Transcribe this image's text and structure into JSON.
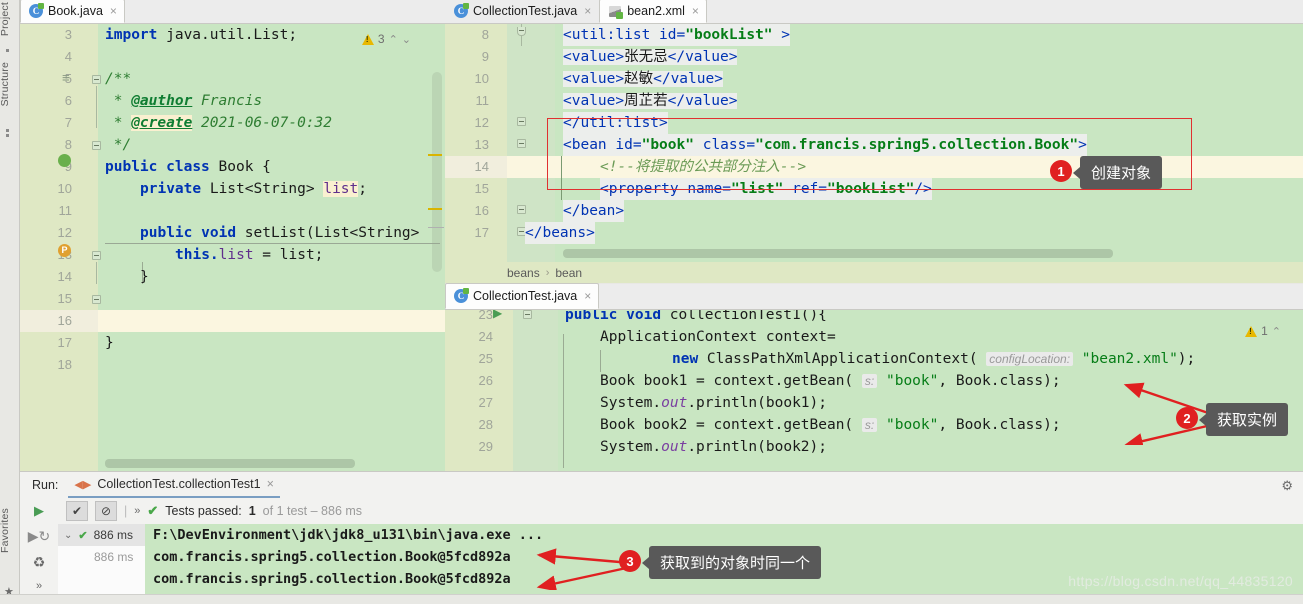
{
  "app": {
    "watermark": "https://blog.csdn.net/qq_44835120"
  },
  "tool_strip": {
    "project_label": "Project",
    "structure_label": "Structure",
    "favorites_label": "Favorites"
  },
  "editor_left": {
    "tab": {
      "label": "Book.java",
      "icon": "java-class-icon",
      "close": "×"
    },
    "inspection": {
      "warn_count": "3",
      "up": "⌃",
      "down": "⌄"
    },
    "line_numbers": [
      "3",
      "4",
      "5",
      "6",
      "7",
      "8",
      "9",
      "10",
      "11",
      "12",
      "13",
      "14",
      "15",
      "16",
      "17",
      "18"
    ],
    "lines": [
      {
        "n": "3",
        "text": "import java.util.List;"
      },
      {
        "n": "4",
        "text": ""
      },
      {
        "n": "5",
        "text": "/**"
      },
      {
        "n": "6",
        "text": " * @author Francis"
      },
      {
        "n": "7",
        "text": " * @create 2021-06-07-0:32"
      },
      {
        "n": "8",
        "text": " */"
      },
      {
        "n": "9",
        "text": "public class Book {"
      },
      {
        "n": "10",
        "text": "    private List<String> list;"
      },
      {
        "n": "11",
        "text": ""
      },
      {
        "n": "12",
        "text": "    public void setList(List<String> list) {"
      },
      {
        "n": "13",
        "text": "        this.list = list;"
      },
      {
        "n": "14",
        "text": "    }"
      },
      {
        "n": "15",
        "text": ""
      },
      {
        "n": "16",
        "text": ""
      },
      {
        "n": "17",
        "text": "}"
      },
      {
        "n": "18",
        "text": ""
      }
    ],
    "tokens": {
      "import_kw": "import",
      "import_pkg": " java.util.List;",
      "doc_open": "/**",
      "doc_star1": " * ",
      "doc_author": "@author",
      "doc_author_val": " Francis",
      "doc_star2": " * ",
      "doc_create": "@create",
      "doc_create_val": " 2021-06-07-0:32",
      "doc_close": " */",
      "public": "public",
      "class": "class",
      "book": "Book",
      "brace_open": "{",
      "private": "private",
      "list_type": "List<String>",
      "list_field": "list",
      "semi": ";",
      "void": "void",
      "setlist": "setList(",
      "list_param": "List<String>",
      "this_list": "this.",
      "assign": " = list;",
      "close_brace": "}",
      "class_close": "}"
    }
  },
  "editor_xml": {
    "tabs": [
      {
        "label": "CollectionTest.java",
        "icon": "java-class-icon",
        "active": false,
        "close": "×"
      },
      {
        "label": "bean2.xml",
        "icon": "xml-file-icon",
        "active": true,
        "close": "×"
      }
    ],
    "line_numbers": [
      "8",
      "9",
      "10",
      "11",
      "12",
      "13",
      "14",
      "15",
      "16",
      "17"
    ],
    "lines": [
      {
        "n": "8",
        "text": "<util:list id=\"bookList\" >"
      },
      {
        "n": "9",
        "text": "    <value>张无忌</value>"
      },
      {
        "n": "10",
        "text": "    <value>赵敏</value>"
      },
      {
        "n": "11",
        "text": "    <value>周芷若</value>"
      },
      {
        "n": "12",
        "text": "</util:list>"
      },
      {
        "n": "13",
        "text": "<bean id=\"book\" class=\"com.francis.spring5.collection.Book\">"
      },
      {
        "n": "14",
        "text": "    <!--将提取的公共部分注入-->"
      },
      {
        "n": "15",
        "text": "    <property name=\"list\" ref=\"bookList\"/>"
      },
      {
        "n": "16",
        "text": "</bean>"
      },
      {
        "n": "17",
        "text": "</beans>"
      }
    ],
    "values": [
      "张无忌",
      "赵敏",
      "周芷若"
    ],
    "bean_id": "book",
    "bean_class": "com.francis.spring5.collection.Book",
    "comment": "<!--将提取的公共部分注入-->",
    "property_name": "list",
    "property_ref": "bookList",
    "breadcrumb": {
      "root": "beans",
      "sep": "›",
      "leaf": "bean"
    }
  },
  "editor_java": {
    "tab": {
      "label": "CollectionTest.java",
      "icon": "java-class-icon",
      "close": "×"
    },
    "inspection": {
      "warn_count": "1",
      "up": "⌃"
    },
    "line_numbers": [
      "23",
      "24",
      "25",
      "26",
      "27",
      "28",
      "29"
    ],
    "lines": [
      {
        "n": "23",
        "text": "public void collectionTest1(){"
      },
      {
        "n": "24",
        "text": "    ApplicationContext context="
      },
      {
        "n": "25",
        "text": "            new ClassPathXmlApplicationContext( configLocation: \"bean2.xml\");"
      },
      {
        "n": "26",
        "text": "    Book book1 = context.getBean( s: \"book\", Book.class);"
      },
      {
        "n": "27",
        "text": "    System.out.println(book1);"
      },
      {
        "n": "28",
        "text": "    Book book2 = context.getBean( s: \"book\", Book.class);"
      },
      {
        "n": "29",
        "text": "    System.out.println(book2);"
      }
    ],
    "tokens": {
      "public": "public",
      "void": "void",
      "method": " collectionTest1(){",
      "appctx": "ApplicationContext context=",
      "new": "new",
      "cpxac": " ClassPathXmlApplicationContext(",
      "hint_config": "configLocation:",
      "xmlfile": "\"bean2.xml\"",
      "close_paren": ");",
      "book_type": "Book",
      "book1": " book1 = context.getBean(",
      "hint_s": "s:",
      "bookname": "\"book\"",
      "book_class": ", Book.class);",
      "sysout_pre": "System.",
      "out": "out",
      "println1": ".println(book1);",
      "book2": " book2 = context.getBean(",
      "println2": ".println(book2);"
    }
  },
  "annotations": [
    {
      "num": "1",
      "text": "创建对象"
    },
    {
      "num": "2",
      "text": "获取实例"
    },
    {
      "num": "3",
      "text": "获取到的对象时同一个"
    }
  ],
  "run_panel": {
    "title": "Run:",
    "config_name": "CollectionTest.collectionTest1",
    "config_close": "×",
    "toolbar_icons": [
      "rerun-icon",
      "rerun-failed-icon",
      "stop-icon",
      "filter-icon"
    ],
    "toolbar": {
      "run_icon": "▶",
      "show_passed_icon": "✔",
      "hide_ignored_icon": "⊘",
      "expand_icon": "»"
    },
    "summary": {
      "check": "✔",
      "label": "Tests passed:",
      "count": "1",
      "suffix": "of 1 test – 886 ms"
    },
    "tree": [
      {
        "expander": "⌄",
        "check": "✔",
        "time": "886 ms",
        "selected": true
      },
      {
        "expander": "",
        "check": "",
        "time": "886 ms",
        "selected": false
      }
    ],
    "console": [
      {
        "text": "F:\\DevEnvironment\\jdk\\jdk8_u131\\bin\\java.exe ...",
        "type": "cmd"
      },
      {
        "text": "com.francis.spring5.collection.Book@5fcd892a",
        "type": "out"
      },
      {
        "text": "com.francis.spring5.collection.Book@5fcd892a",
        "type": "out"
      }
    ],
    "settings_icon": "⚙"
  },
  "colors": {
    "editor_bg": "#c9e6c2",
    "gutter_bg": "#dfe8c4",
    "highlight_line": "#fbf6e0",
    "annotation_red": "#e02020",
    "bubble_bg": "#595959",
    "keyword_blue": "#0033b3",
    "string_green": "#067d17"
  }
}
